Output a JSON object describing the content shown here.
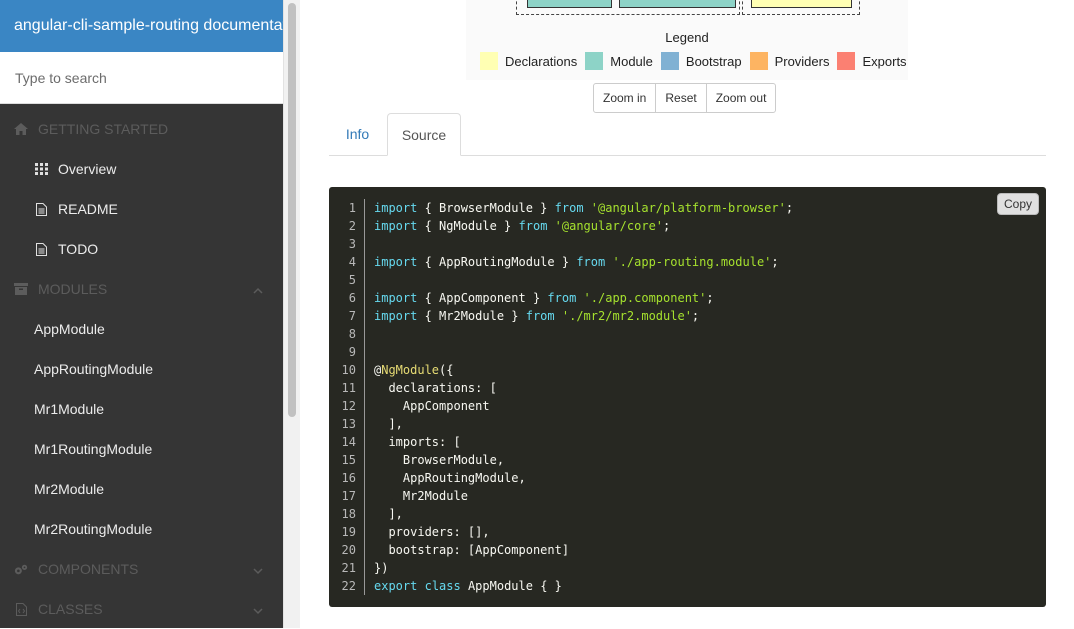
{
  "sidebar": {
    "title": "angular-cli-sample-routing documentat...",
    "search_placeholder": "Type to search",
    "sections": {
      "getting_started": "GETTING STARTED",
      "modules": "MODULES",
      "components": "COMPONENTS",
      "classes": "CLASSES"
    },
    "getting_started_items": [
      "Overview",
      "README",
      "TODO"
    ],
    "module_items": [
      "AppModule",
      "AppRoutingModule",
      "Mr1Module",
      "Mr1RoutingModule",
      "Mr2Module",
      "Mr2RoutingModule"
    ]
  },
  "graph": {
    "legend_title": "Legend",
    "legend": [
      {
        "label": "Declarations",
        "color": "#ffffb3"
      },
      {
        "label": "Module",
        "color": "#8dd3c7"
      },
      {
        "label": "Bootstrap",
        "color": "#80b1d3"
      },
      {
        "label": "Providers",
        "color": "#fdb462"
      },
      {
        "label": "Exports",
        "color": "#fb8072"
      }
    ],
    "zoom_in": "Zoom in",
    "reset": "Reset",
    "zoom_out": "Zoom out"
  },
  "tabs": {
    "info": "Info",
    "source": "Source"
  },
  "code": {
    "copy_label": "Copy",
    "lines": [
      "import { BrowserModule } from '@angular/platform-browser';",
      "import { NgModule } from '@angular/core';",
      "",
      "import { AppRoutingModule } from './app-routing.module';",
      "",
      "import { AppComponent } from './app.component';",
      "import { Mr2Module } from './mr2/mr2.module';",
      "",
      "",
      "@NgModule({",
      "  declarations: [",
      "    AppComponent",
      "  ],",
      "  imports: [",
      "    BrowserModule,",
      "    AppRoutingModule,",
      "    Mr2Module",
      "  ],",
      "  providers: [],",
      "  bootstrap: [AppComponent]",
      "})",
      "export class AppModule { }"
    ]
  }
}
